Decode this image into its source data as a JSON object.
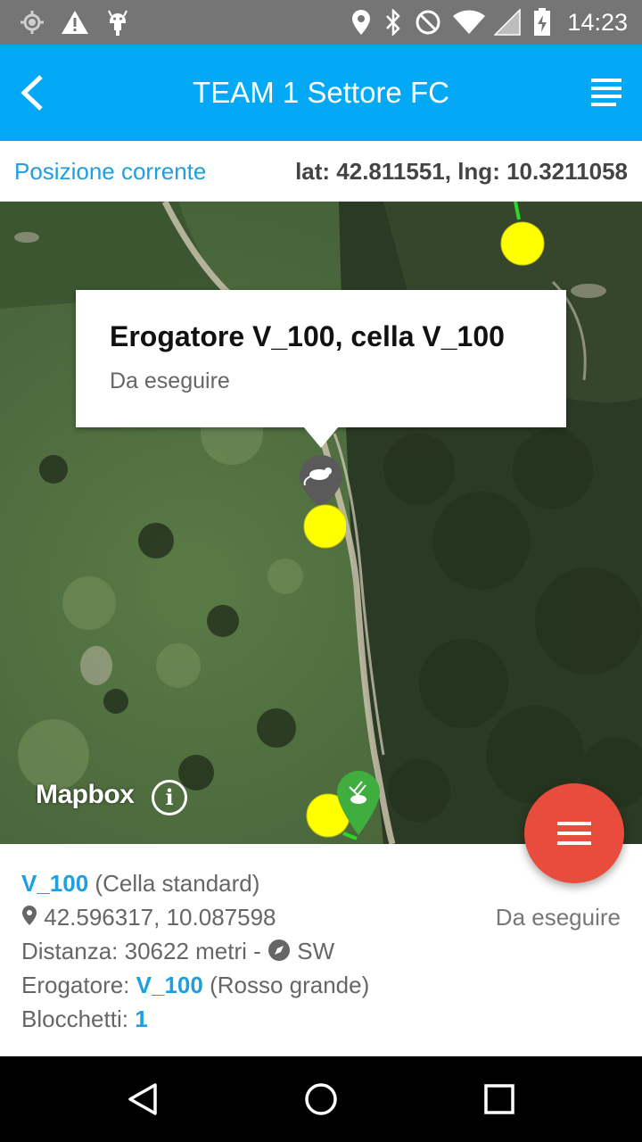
{
  "status_bar": {
    "time": "14:23",
    "icons": [
      "gps-icon",
      "warning-icon",
      "android-icon",
      "location-pin-icon",
      "bluetooth-icon",
      "do-not-disturb-icon",
      "wifi-icon",
      "signal-icon",
      "battery-icon"
    ]
  },
  "app_bar": {
    "title": "TEAM 1 Settore FC",
    "back_icon": "chevron-left-icon",
    "menu_icon": "list-icon"
  },
  "position": {
    "label": "Posizione corrente",
    "coords": "lat: 42.811551, lng: 10.3211058"
  },
  "map": {
    "popup_title": "Erogatore V_100, cella V_100",
    "popup_subtitle": "Da eseguire",
    "attribution": "Mapbox",
    "info_icon_text": "i",
    "marker_colors": {
      "point": "#ffff00",
      "pending": "#5a5a5a",
      "done": "#3fae3f"
    }
  },
  "info": {
    "cell_id": "V_100",
    "cell_type": "(Cella standard)",
    "coords": "42.596317, 10.087598",
    "status": "Da eseguire",
    "distance": "Distanza: 30622 metri -",
    "direction": "SW",
    "dispenser_label": "Erogatore:",
    "dispenser_id": "V_100",
    "dispenser_type": "(Rosso grande)",
    "blocks_label": "Blocchetti:",
    "blocks_value": "1"
  },
  "colors": {
    "primary": "#03a9f4",
    "accent": "#e84c3d",
    "link": "#1e9fdf"
  }
}
